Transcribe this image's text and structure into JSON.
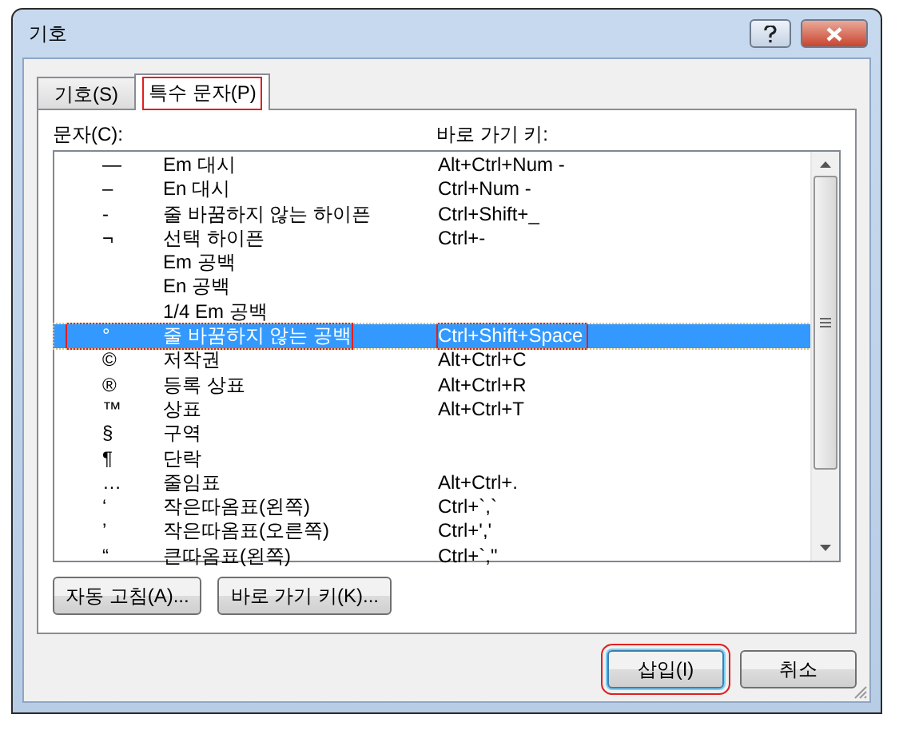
{
  "window": {
    "title": "기호"
  },
  "tabs": [
    {
      "label": "기호(S)",
      "selected": false
    },
    {
      "label": "특수 문자(P)",
      "selected": true
    }
  ],
  "columns": [
    "문자(C):",
    "바로 가기 키:"
  ],
  "rows": [
    {
      "symbol": "—",
      "name": "Em 대시",
      "shortcut": "Alt+Ctrl+Num -",
      "selected": false
    },
    {
      "symbol": "–",
      "name": "En 대시",
      "shortcut": "Ctrl+Num -",
      "selected": false
    },
    {
      "symbol": "-",
      "name": "줄 바꿈하지 않는 하이픈",
      "shortcut": "Ctrl+Shift+_",
      "selected": false
    },
    {
      "symbol": "¬",
      "name": "선택 하이픈",
      "shortcut": "Ctrl+-",
      "selected": false
    },
    {
      "name": "Em 공백",
      "selected": false
    },
    {
      "name": "En 공백",
      "selected": false
    },
    {
      "name": "1/4 Em 공백",
      "selected": false
    },
    {
      "symbol": "°",
      "name": "줄 바꿈하지 않는 공백",
      "shortcut": "Ctrl+Shift+Space",
      "selected": true
    },
    {
      "symbol": "©",
      "name": "저작권",
      "shortcut": "Alt+Ctrl+C",
      "selected": false
    },
    {
      "symbol": "®",
      "name": "등록 상표",
      "shortcut": "Alt+Ctrl+R",
      "selected": false
    },
    {
      "symbol": "™",
      "name": "상표",
      "shortcut": "Alt+Ctrl+T",
      "selected": false
    },
    {
      "symbol": "§",
      "name": "구역",
      "selected": false
    },
    {
      "symbol": "¶",
      "name": "단락",
      "selected": false
    },
    {
      "symbol": "…",
      "name": "줄임표",
      "shortcut": "Alt+Ctrl+.",
      "selected": false
    },
    {
      "symbol": "‘",
      "name": "작은따옴표(왼쪽)",
      "shortcut": "Ctrl+`,`",
      "selected": false
    },
    {
      "symbol": "’",
      "name": "작은따옴표(오른쪽)",
      "shortcut": "Ctrl+','",
      "selected": false
    },
    {
      "symbol": "“",
      "name": "큰따옴표(왼쪽)",
      "shortcut": "Ctrl+`,\"",
      "selected": false
    }
  ],
  "panel_buttons": [
    "자동 고침(A)...",
    "바로 가기 키(K)..."
  ],
  "dialog_buttons": [
    {
      "label": "삽입(I)",
      "highlighted": true
    },
    {
      "label": "취소",
      "highlighted": false
    }
  ]
}
